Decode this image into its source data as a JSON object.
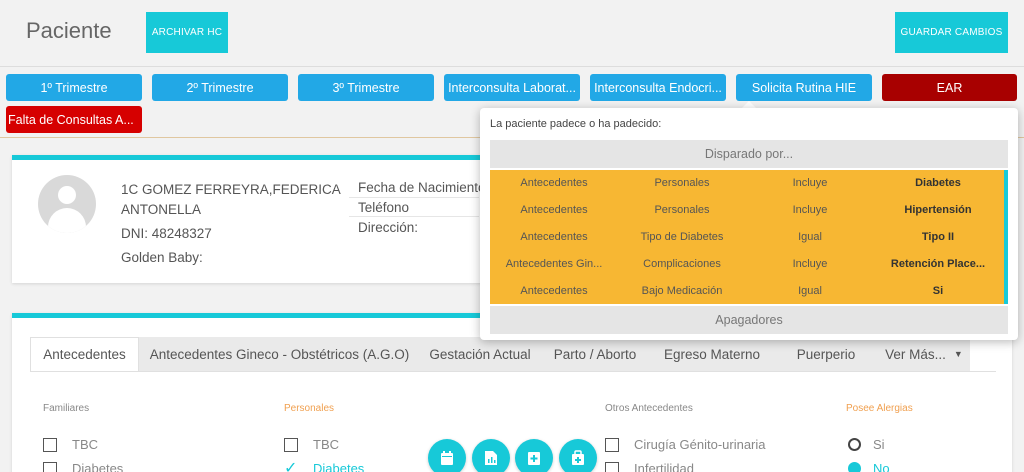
{
  "header": {
    "title": "Paciente",
    "archive_button": "ARCHIVAR HC",
    "save_button": "GUARDAR CAMBIOS"
  },
  "top_buttons": [
    {
      "label": "1º Trimestre"
    },
    {
      "label": "2º Trimestre"
    },
    {
      "label": "3º Trimestre"
    },
    {
      "label": "Interconsulta Laborat..."
    },
    {
      "label": "Interconsulta Endocri..."
    },
    {
      "label": "Solicita Rutina HIE"
    },
    {
      "label": "EAR"
    },
    {
      "label": "Falta de Consultas A..."
    }
  ],
  "patient": {
    "name_line1": "1C GOMEZ FERREYRA,FEDERICA",
    "name_line2": "ANTONELLA",
    "dni": "DNI: 48248327",
    "extra": "Golden Baby:",
    "fields": [
      "Fecha de Nacimiento",
      "Teléfono",
      "Dirección:"
    ]
  },
  "tabs": [
    {
      "label": "Antecedentes"
    },
    {
      "label": "Antecedentes Gineco - Obstétricos (A.G.O)"
    },
    {
      "label": "Gestación Actual"
    },
    {
      "label": "Parto / Aborto"
    },
    {
      "label": "Egreso Materno"
    },
    {
      "label": "Puerperio"
    },
    {
      "label": "Ver Más..."
    }
  ],
  "sections": {
    "familiares": {
      "title": "Familiares",
      "items": [
        "TBC",
        "Diabetes"
      ]
    },
    "personales": {
      "title": "Personales",
      "items": [
        "TBC",
        "Diabetes"
      ]
    },
    "otros": {
      "title": "Otros Antecedentes",
      "items": [
        "Cirugía Génito-urinaria",
        "Infertilidad"
      ]
    },
    "alergias": {
      "title": "Posee Alergias",
      "options": [
        "Si",
        "No"
      ],
      "selected": "No"
    }
  },
  "popover": {
    "title": "La paciente padece o ha padecido:",
    "triggered_by": "Disparado por...",
    "switches_off": "Apagadores",
    "rows": [
      [
        "Antecedentes",
        "Personales",
        "Incluye",
        "Diabetes"
      ],
      [
        "Antecedentes",
        "Personales",
        "Incluye",
        "Hipertensión"
      ],
      [
        "Antecedentes",
        "Tipo de Diabetes",
        "Igual",
        "Tipo II"
      ],
      [
        "Antecedentes Gin...",
        "Complicaciones",
        "Incluye",
        "Retención Place..."
      ],
      [
        "Antecedentes",
        "Bajo Medicación",
        "Igual",
        "Si"
      ]
    ]
  },
  "fab_icons": [
    "calendar-icon",
    "document-chart-icon",
    "add-report-icon",
    "medical-bag-icon"
  ],
  "colors": {
    "accent": "#17c9d8",
    "blue": "#22a8e6",
    "dark_red": "#a80000",
    "red": "#d60000",
    "amber": "#f7b733"
  }
}
